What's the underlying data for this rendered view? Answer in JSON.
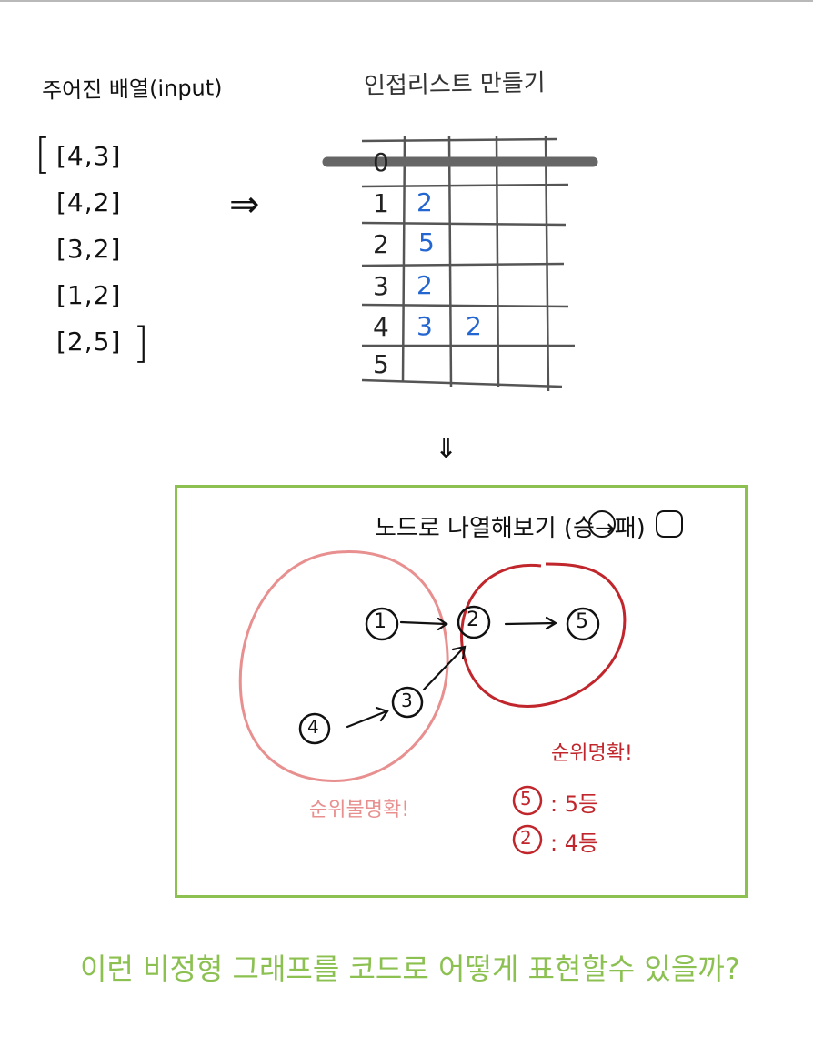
{
  "input": {
    "title": "주어진 배열(input)",
    "pairs": [
      "[4,3]",
      "[4,2]",
      "[3,2]",
      "[1,2]",
      "[2,5]"
    ]
  },
  "adjacency": {
    "title": "인접리스트 만들기",
    "indices": [
      "0",
      "1",
      "2",
      "3",
      "4",
      "5"
    ],
    "rows": {
      "1": [
        "2"
      ],
      "2": [
        "5"
      ],
      "3": [
        "2"
      ],
      "4": [
        "3",
        "2"
      ],
      "5": []
    }
  },
  "graph": {
    "title": "노드로 나열해보기 (승→패)",
    "win_symbol": "승",
    "lose_symbol": "패",
    "nodes": [
      "1",
      "2",
      "5",
      "4",
      "3"
    ],
    "determined_label": "순위명확!",
    "undetermined_label": "순위불명확!",
    "ranks": [
      {
        "node": "5",
        "text": ": 5등"
      },
      {
        "node": "2",
        "text": ": 4등"
      }
    ]
  },
  "question": "이런 비정형 그래프를 코드로 어떻게 표현할수 있을까?",
  "colors": {
    "blue": "#2366d1",
    "green": "#8cc152",
    "dark_red": "#c0262b",
    "pink": "#e88f8f",
    "gray": "#555555"
  }
}
